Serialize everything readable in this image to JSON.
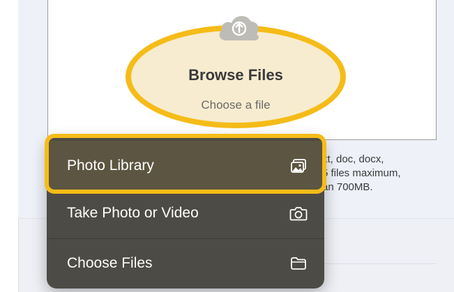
{
  "drop_zone": {
    "icon": "cloud-upload-icon",
    "title": "Browse Files",
    "subtitle": "Choose a file"
  },
  "info": {
    "line1": "xt, doc, docx,",
    "line2": "5 files maximum,",
    "line3": "an 700MB."
  },
  "menu": {
    "items": [
      {
        "label": "Photo Library",
        "icon": "photo-library-icon"
      },
      {
        "label": "Take Photo or Video",
        "icon": "camera-icon"
      },
      {
        "label": "Choose Files",
        "icon": "folder-icon"
      }
    ]
  },
  "colors": {
    "highlight": "#f5bc18",
    "menu_bg": "#4d4b45",
    "menu_selected_bg": "#5c5541"
  }
}
